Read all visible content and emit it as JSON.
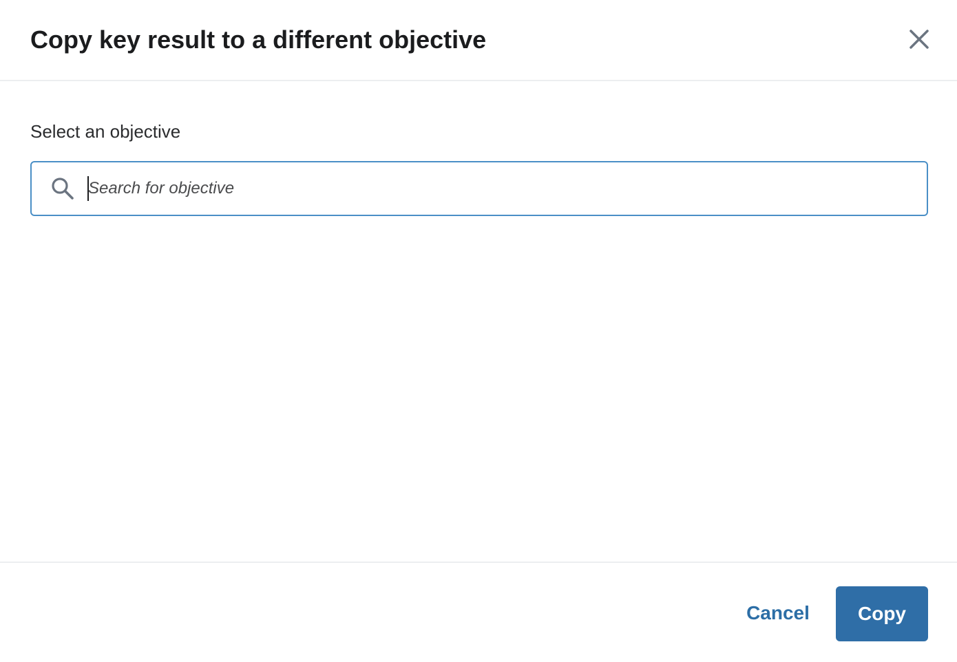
{
  "dialog": {
    "title": "Copy key result to a different objective",
    "close_icon": "close-icon"
  },
  "form": {
    "label": "Select an objective",
    "search": {
      "placeholder": "Search for objective",
      "value": "",
      "icon": "search-icon"
    }
  },
  "footer": {
    "cancel_label": "Cancel",
    "copy_label": "Copy"
  },
  "colors": {
    "accent": "#2f6ea7",
    "link": "#2c6ea6",
    "focus_border": "#4a8fc6",
    "divider": "#eceef0",
    "icon": "#6b7480"
  }
}
